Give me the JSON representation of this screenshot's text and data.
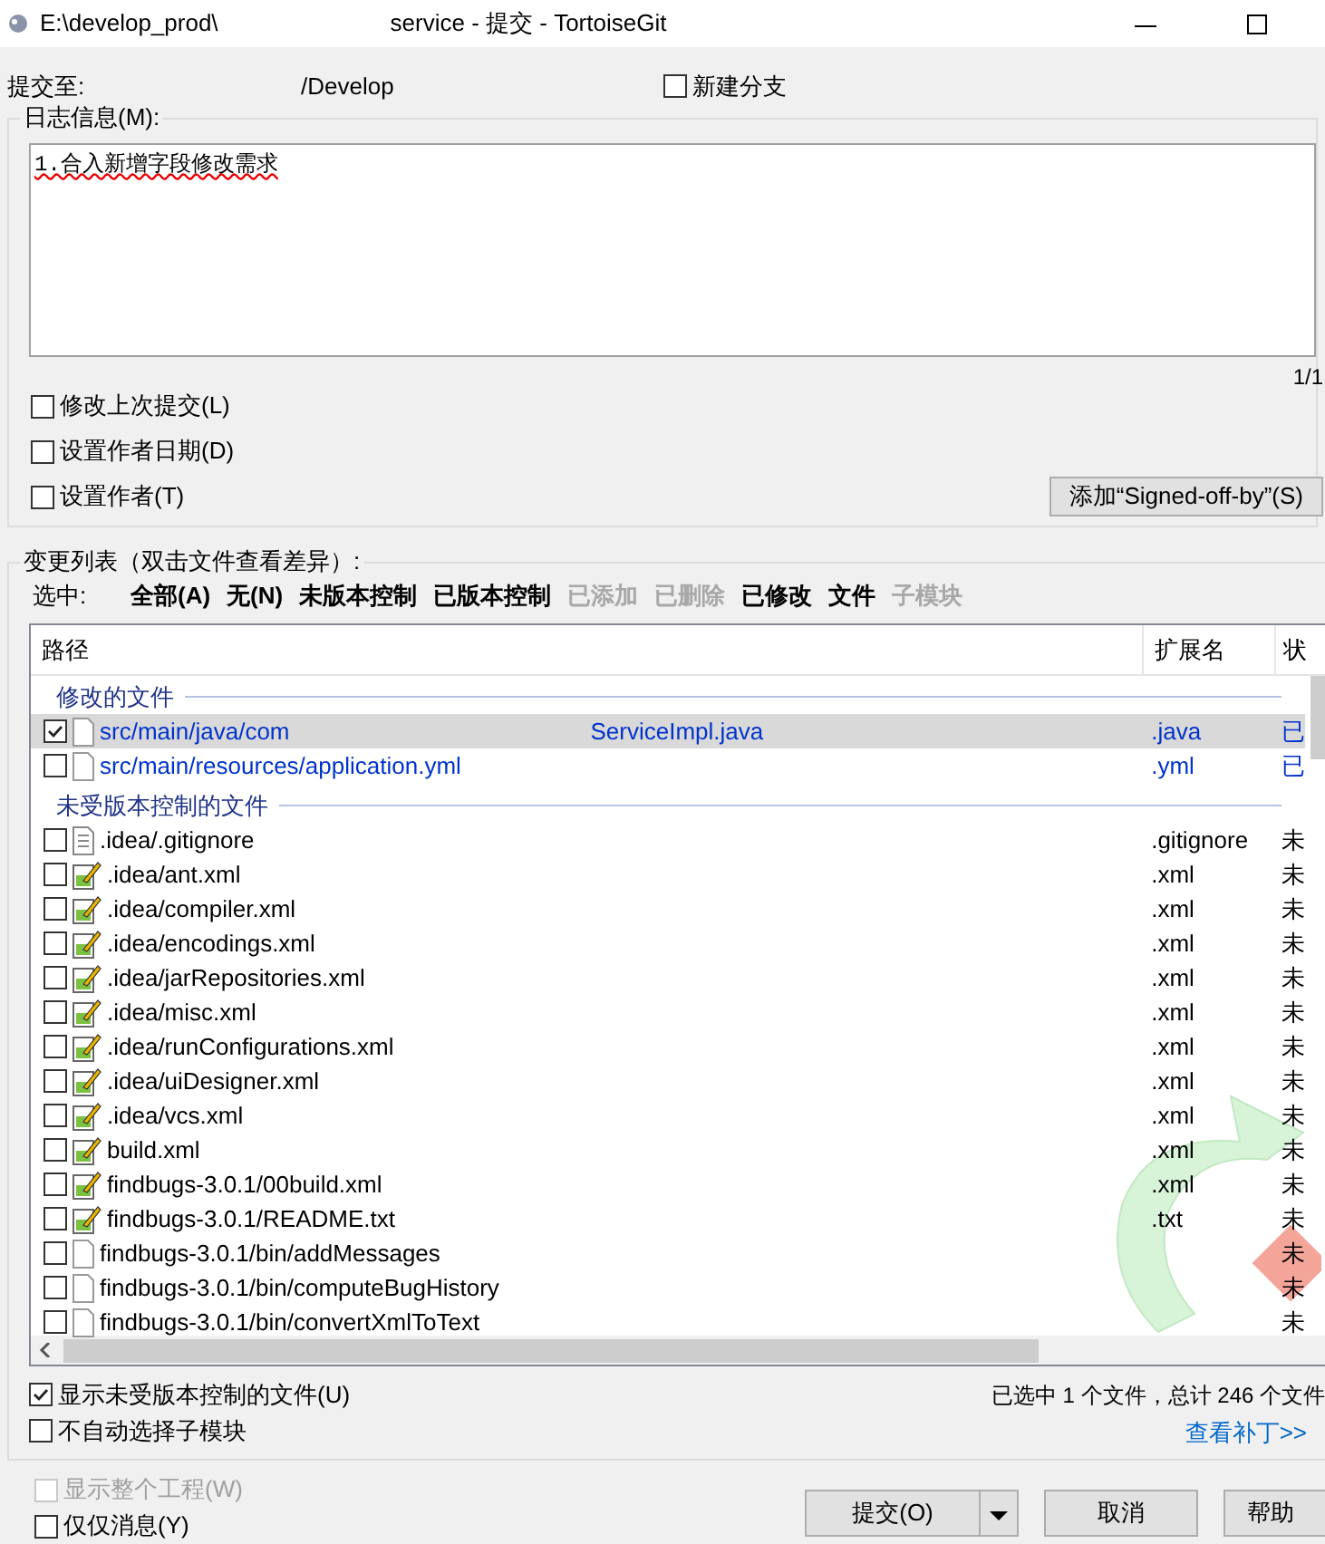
{
  "window": {
    "title_start": "E:\\develop_prod\\",
    "title_end": "service - 提交 - TortoiseGit"
  },
  "commit_to": {
    "label": "提交至:",
    "branch": "/Develop"
  },
  "new_branch": {
    "label": "新建分支",
    "checked": false
  },
  "message": {
    "legend": "日志信息(M):",
    "value": "1.合入新增字段修改需求",
    "counter": "1/1"
  },
  "message_options": [
    {
      "label": "修改上次提交(L)",
      "checked": false
    },
    {
      "label": "设置作者日期(D)",
      "checked": false
    },
    {
      "label": "设置作者(T)",
      "checked": false
    }
  ],
  "signoff_button": "添加“Signed-off-by”(S)",
  "changes": {
    "legend": "变更列表（双击文件查看差异）:",
    "select_label": "选中:",
    "filters": [
      {
        "label": "全部(A)",
        "disabled": false
      },
      {
        "label": "无(N)",
        "disabled": false
      },
      {
        "label": "未版本控制",
        "disabled": false
      },
      {
        "label": "已版本控制",
        "disabled": false
      },
      {
        "label": "已添加",
        "disabled": true
      },
      {
        "label": "已删除",
        "disabled": true
      },
      {
        "label": "已修改",
        "disabled": false
      },
      {
        "label": "文件",
        "disabled": false
      },
      {
        "label": "子模块",
        "disabled": true
      }
    ],
    "columns": [
      "路径",
      "扩展名",
      "状"
    ],
    "groups": [
      {
        "title": "修改的文件",
        "rows": [
          {
            "path_start": "src/main/java/com",
            "path_end": "ServiceImpl.java",
            "ext": ".java",
            "status": "已",
            "checked": true,
            "selected": true,
            "kind": "file"
          },
          {
            "path_start": "src/main/resources/application.yml",
            "ext": ".yml",
            "status": "已",
            "checked": false,
            "selected": false,
            "kind": "file"
          }
        ]
      },
      {
        "title": "未受版本控制的文件",
        "rows": [
          {
            "path_start": ".idea/.gitignore",
            "ext": ".gitignore",
            "status": "未",
            "checked": false,
            "selected": false,
            "kind": "text"
          },
          {
            "path_start": ".idea/ant.xml",
            "ext": ".xml",
            "status": "未",
            "checked": false,
            "selected": false,
            "kind": "edited"
          },
          {
            "path_start": ".idea/compiler.xml",
            "ext": ".xml",
            "status": "未",
            "checked": false,
            "selected": false,
            "kind": "edited"
          },
          {
            "path_start": ".idea/encodings.xml",
            "ext": ".xml",
            "status": "未",
            "checked": false,
            "selected": false,
            "kind": "edited"
          },
          {
            "path_start": ".idea/jarRepositories.xml",
            "ext": ".xml",
            "status": "未",
            "checked": false,
            "selected": false,
            "kind": "edited"
          },
          {
            "path_start": ".idea/misc.xml",
            "ext": ".xml",
            "status": "未",
            "checked": false,
            "selected": false,
            "kind": "edited"
          },
          {
            "path_start": ".idea/runConfigurations.xml",
            "ext": ".xml",
            "status": "未",
            "checked": false,
            "selected": false,
            "kind": "edited"
          },
          {
            "path_start": ".idea/uiDesigner.xml",
            "ext": ".xml",
            "status": "未",
            "checked": false,
            "selected": false,
            "kind": "edited"
          },
          {
            "path_start": ".idea/vcs.xml",
            "ext": ".xml",
            "status": "未",
            "checked": false,
            "selected": false,
            "kind": "edited"
          },
          {
            "path_start": "build.xml",
            "ext": ".xml",
            "status": "未",
            "checked": false,
            "selected": false,
            "kind": "edited"
          },
          {
            "path_start": "findbugs-3.0.1/00build.xml",
            "ext": ".xml",
            "status": "未",
            "checked": false,
            "selected": false,
            "kind": "edited"
          },
          {
            "path_start": "findbugs-3.0.1/README.txt",
            "ext": ".txt",
            "status": "未",
            "checked": false,
            "selected": false,
            "kind": "edited"
          },
          {
            "path_start": "findbugs-3.0.1/bin/addMessages",
            "status": "未",
            "checked": false,
            "selected": false,
            "kind": "file"
          },
          {
            "path_start": "findbugs-3.0.1/bin/computeBugHistory",
            "status": "未",
            "checked": false,
            "selected": false,
            "kind": "file"
          },
          {
            "path_start": "findbugs-3.0.1/bin/convertXmlToText",
            "status": "未",
            "checked": false,
            "selected": false,
            "kind": "file"
          }
        ]
      }
    ],
    "list_options": [
      {
        "label": "显示未受版本控制的文件(U)",
        "checked": true
      },
      {
        "label": "不自动选择子模块",
        "checked": false
      }
    ],
    "summary": "已选中 1 个文件，总计 246 个文件",
    "patch_link": "查看补丁>>"
  },
  "bottom_options": [
    {
      "label": "显示整个工程(W)",
      "checked": false,
      "disabled": true
    },
    {
      "label": "仅仅消息(Y)",
      "checked": false,
      "disabled": false
    }
  ],
  "buttons": {
    "commit": "提交(O)",
    "cancel": "取消",
    "help": "帮助"
  }
}
